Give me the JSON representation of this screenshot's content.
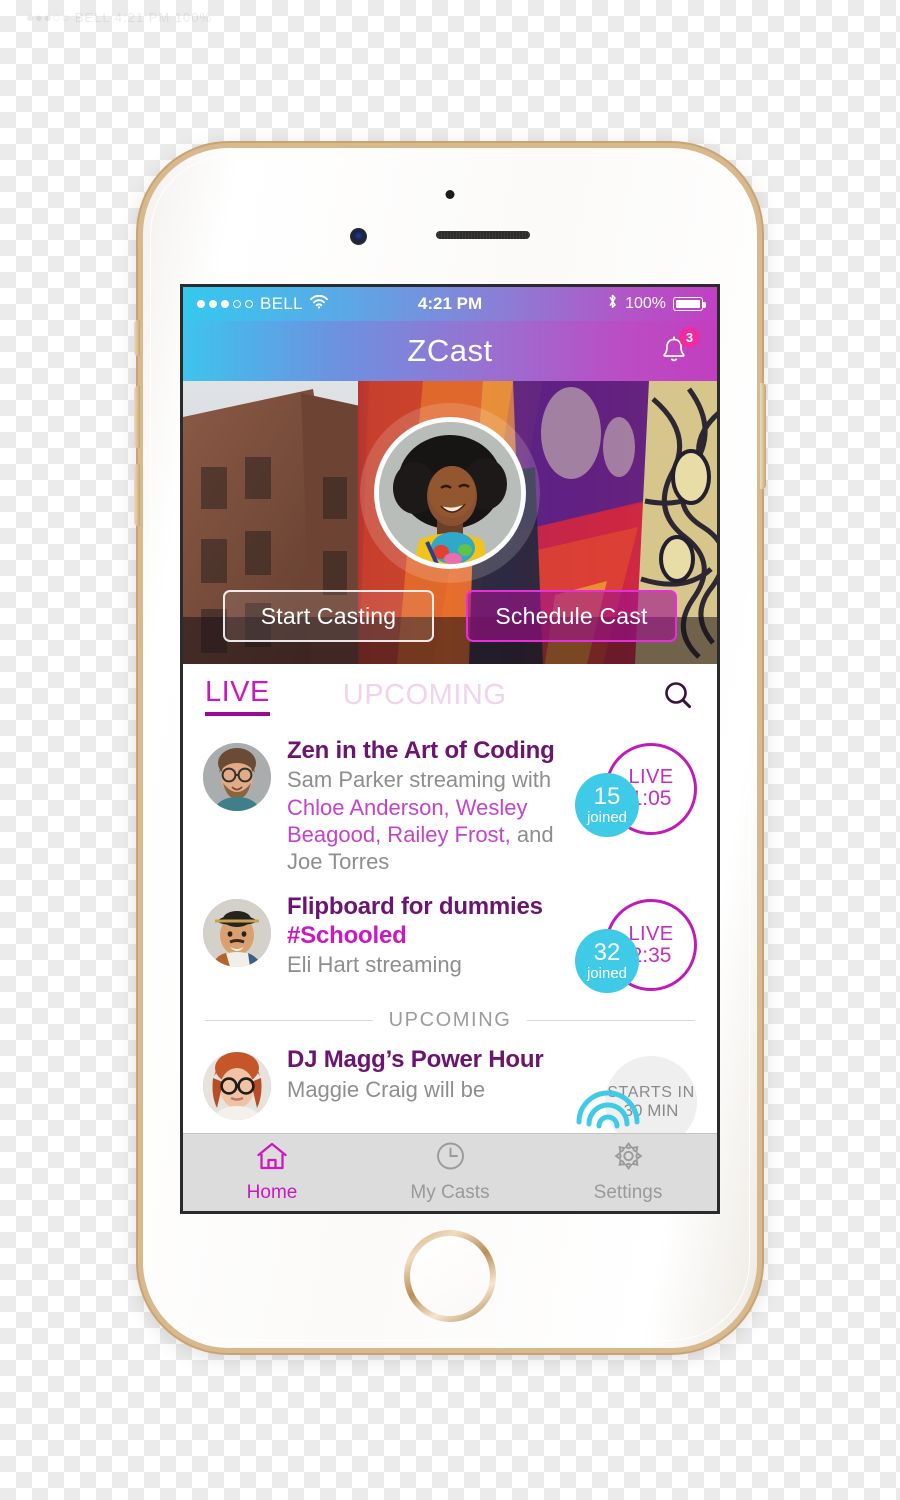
{
  "watermark": "●●●○○ BELL    4:21 PM    100%",
  "status_bar": {
    "carrier": "BELL",
    "signal_filled": 3,
    "signal_total": 5,
    "wifi_icon": "wifi-icon",
    "time": "4:21 PM",
    "bluetooth_icon": "bluetooth-icon",
    "battery_percent": "100%",
    "battery_icon": "battery-icon"
  },
  "nav_bar": {
    "title": "ZCast",
    "bell_icon": "bell-icon",
    "notification_count": "3"
  },
  "hero": {
    "portrait_alt": "host-portrait",
    "primary_button": "Start Casting",
    "secondary_button": "Schedule Cast"
  },
  "tabs": {
    "live": "LIVE",
    "upcoming": "UPCOMING",
    "search_icon": "search-icon"
  },
  "list": {
    "items": [
      {
        "title": "Zen in the Art of Coding",
        "sub_prefix": "Sam Parker streaming with ",
        "guests": "Chloe Anderson, Wesley Beagood, Railey Frost,",
        "sub_suffix": " and Joe Torres",
        "joined_count": "15",
        "joined_label": "joined",
        "status_label": "LIVE",
        "status_time": "1:05"
      },
      {
        "title": "Flipboard for dummies ",
        "hashtag": "#Schooled",
        "sub_prefix": "Eli Hart streaming",
        "joined_count": "32",
        "joined_label": "joined",
        "status_label": "LIVE",
        "status_time": "2:35"
      }
    ],
    "upcoming_divider": "UPCOMING",
    "upcoming_item": {
      "title": "DJ Magg’s Power Hour",
      "sub": "Maggie Craig will be",
      "status_label": "STARTS IN",
      "status_time": "30 MIN"
    }
  },
  "tab_bar": {
    "items": [
      {
        "label": "Home",
        "icon": "home-icon",
        "active": true
      },
      {
        "label": "My Casts",
        "icon": "clock-icon",
        "active": false
      },
      {
        "label": "Settings",
        "icon": "gear-icon",
        "active": false
      }
    ]
  },
  "colors": {
    "accent_magenta": "#cc18c0",
    "accent_purple": "#6b1470",
    "accent_cyan": "#3fcbe8",
    "badge_pink": "#ee2ba0",
    "muted_gray": "#8e8e8e"
  }
}
